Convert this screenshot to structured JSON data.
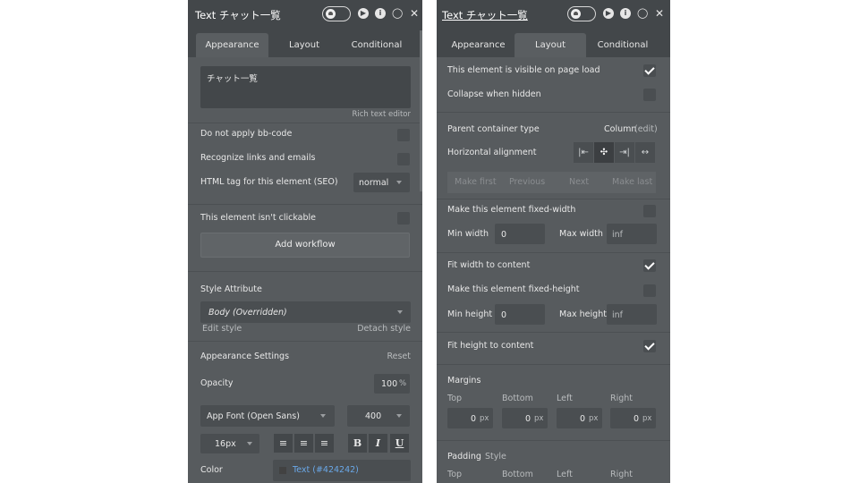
{
  "appearance_panel": {
    "title": "Text チャット一覧",
    "tabs": [
      "Appearance",
      "Layout",
      "Conditional"
    ],
    "rich_text": "チャット一覧",
    "rich_text_editor_label": "Rich text editor",
    "do_not_apply_bbcode": "Do not apply bb-code",
    "recognize_links": "Recognize links and emails",
    "html_tag_label": "HTML tag for this element (SEO)",
    "html_tag_value": "normal",
    "not_clickable": "This element isn't clickable",
    "add_workflow": "Add workflow",
    "style_attribute": "Style Attribute",
    "style_value": "Body (Overridden)",
    "edit_style": "Edit style",
    "detach_style": "Detach style",
    "appearance_settings": "Appearance Settings",
    "reset": "Reset",
    "opacity_label": "Opacity",
    "opacity_value": "100",
    "opacity_unit": "%",
    "font_family": "App Font (Open Sans)",
    "font_weight": "400",
    "font_size": "16px",
    "bold": "B",
    "italic": "I",
    "underline": "U",
    "color_label": "Color",
    "color_value": "Text (#424242)"
  },
  "layout_panel": {
    "title": "Text チャット一覧",
    "tabs": [
      "Appearance",
      "Layout",
      "Conditional"
    ],
    "visible_on_load": "This element is visible on page load",
    "collapse_hidden": "Collapse when hidden",
    "parent_container_type": "Parent container type",
    "container_value": "Column",
    "edit": "(edit)",
    "horizontal_alignment": "Horizontal alignment",
    "pagination": [
      "Make first",
      "Previous",
      "Next",
      "Make last"
    ],
    "fixed_width": "Make this element fixed-width",
    "min_width_label": "Min width",
    "min_width_value": "0",
    "max_width_label": "Max width",
    "max_width_value": "inf",
    "fit_width": "Fit width to content",
    "fixed_height": "Make this element fixed-height",
    "min_height_label": "Min height",
    "min_height_value": "0",
    "max_height_label": "Max height",
    "max_height_value": "inf",
    "fit_height": "Fit height to content",
    "margins": "Margins",
    "sides": [
      "Top",
      "Bottom",
      "Left",
      "Right"
    ],
    "margin_values": [
      "0",
      "0",
      "0",
      "0"
    ],
    "unit_px": "px",
    "padding": "Padding",
    "padding_style": "Style"
  },
  "colors": {
    "panel_bg": "#575b5e",
    "header_bg": "#43474a",
    "field_bg": "#4a4e51",
    "link_blue": "#6aa8e8"
  }
}
